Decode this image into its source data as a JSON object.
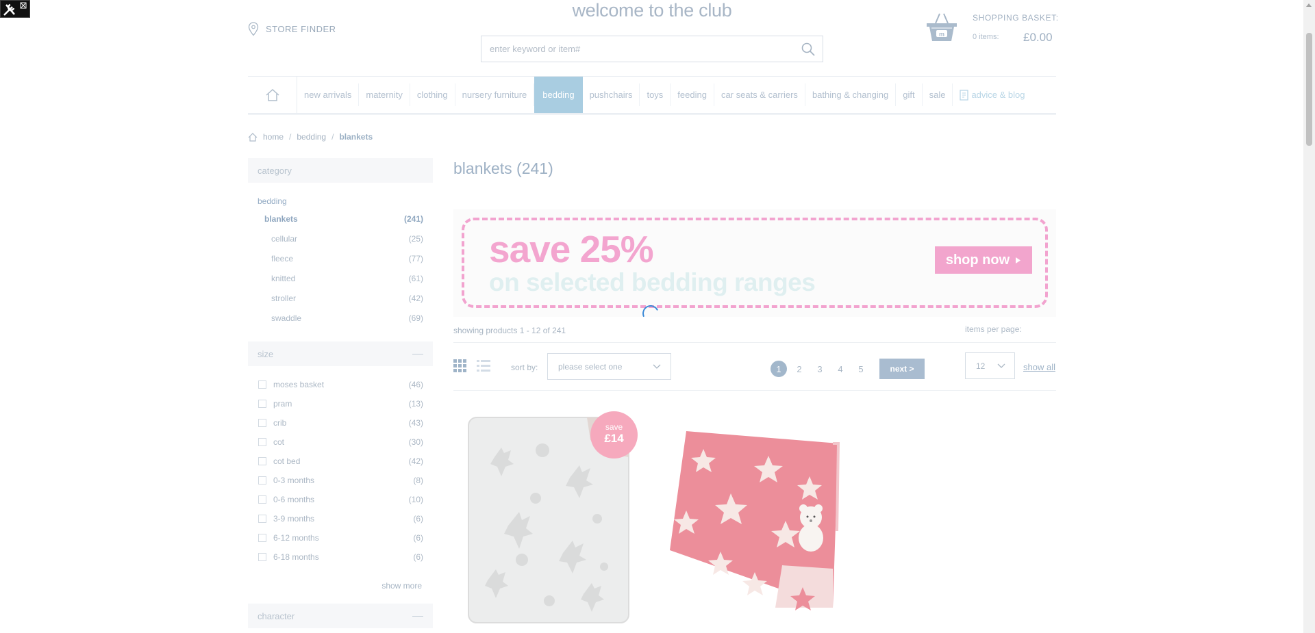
{
  "header": {
    "store_finder": "STORE FINDER",
    "welcome": "welcome to the club",
    "search_placeholder": "enter keyword or item#",
    "basket_title": "SHOPPING BASKET:",
    "basket_items": "0 items:",
    "basket_total": "£0.00"
  },
  "nav": {
    "items": [
      "new arrivals",
      "maternity",
      "clothing",
      "nursery furniture",
      "bedding",
      "pushchairs",
      "toys",
      "feeding",
      "car seats & carriers",
      "bathing & changing",
      "gift",
      "sale",
      "advice & blog"
    ],
    "active": "bedding"
  },
  "breadcrumb": {
    "home": "home",
    "sep": "/",
    "level1": "bedding",
    "current": "blankets"
  },
  "sidebar": {
    "category_header": "category",
    "root": "bedding",
    "current": {
      "label": "blankets",
      "count": "(241)"
    },
    "subcategories": [
      {
        "label": "cellular",
        "count": "(25)"
      },
      {
        "label": "fleece",
        "count": "(77)"
      },
      {
        "label": "knitted",
        "count": "(61)"
      },
      {
        "label": "stroller",
        "count": "(42)"
      },
      {
        "label": "swaddle",
        "count": "(69)"
      }
    ],
    "size_header": "size",
    "sizes": [
      {
        "label": "moses basket",
        "count": "(46)"
      },
      {
        "label": "pram",
        "count": "(13)"
      },
      {
        "label": "crib",
        "count": "(43)"
      },
      {
        "label": "cot",
        "count": "(30)"
      },
      {
        "label": "cot bed",
        "count": "(42)"
      },
      {
        "label": "0-3 months",
        "count": "(8)"
      },
      {
        "label": "0-6 months",
        "count": "(10)"
      },
      {
        "label": "3-9 months",
        "count": "(6)"
      },
      {
        "label": "6-12 months",
        "count": "(6)"
      },
      {
        "label": "6-18 months",
        "count": "(6)"
      }
    ],
    "show_more": "show more",
    "character_header": "character"
  },
  "main": {
    "title": "blankets (241)",
    "banner": {
      "headline": "save 25%",
      "subline": "on selected bedding ranges",
      "cta": "shop now"
    },
    "showing": "showing products 1 - 12 of 241",
    "items_per_page_label": "items per page:",
    "sort_label": "sort by:",
    "sort_value": "please select one",
    "pages": [
      "1",
      "2",
      "3",
      "4",
      "5"
    ],
    "current_page": "1",
    "next_label": "next >",
    "items_per_page_value": "12",
    "show_all": "show all"
  },
  "products": [
    {
      "badge_line1": "save",
      "badge_line2": "£14"
    }
  ],
  "colors": {
    "active_nav": "#a9cde1",
    "banner_pink": "#f3a5cf",
    "badge_pink": "#f6a9bd",
    "blanket_red": "#ec8e9a"
  }
}
